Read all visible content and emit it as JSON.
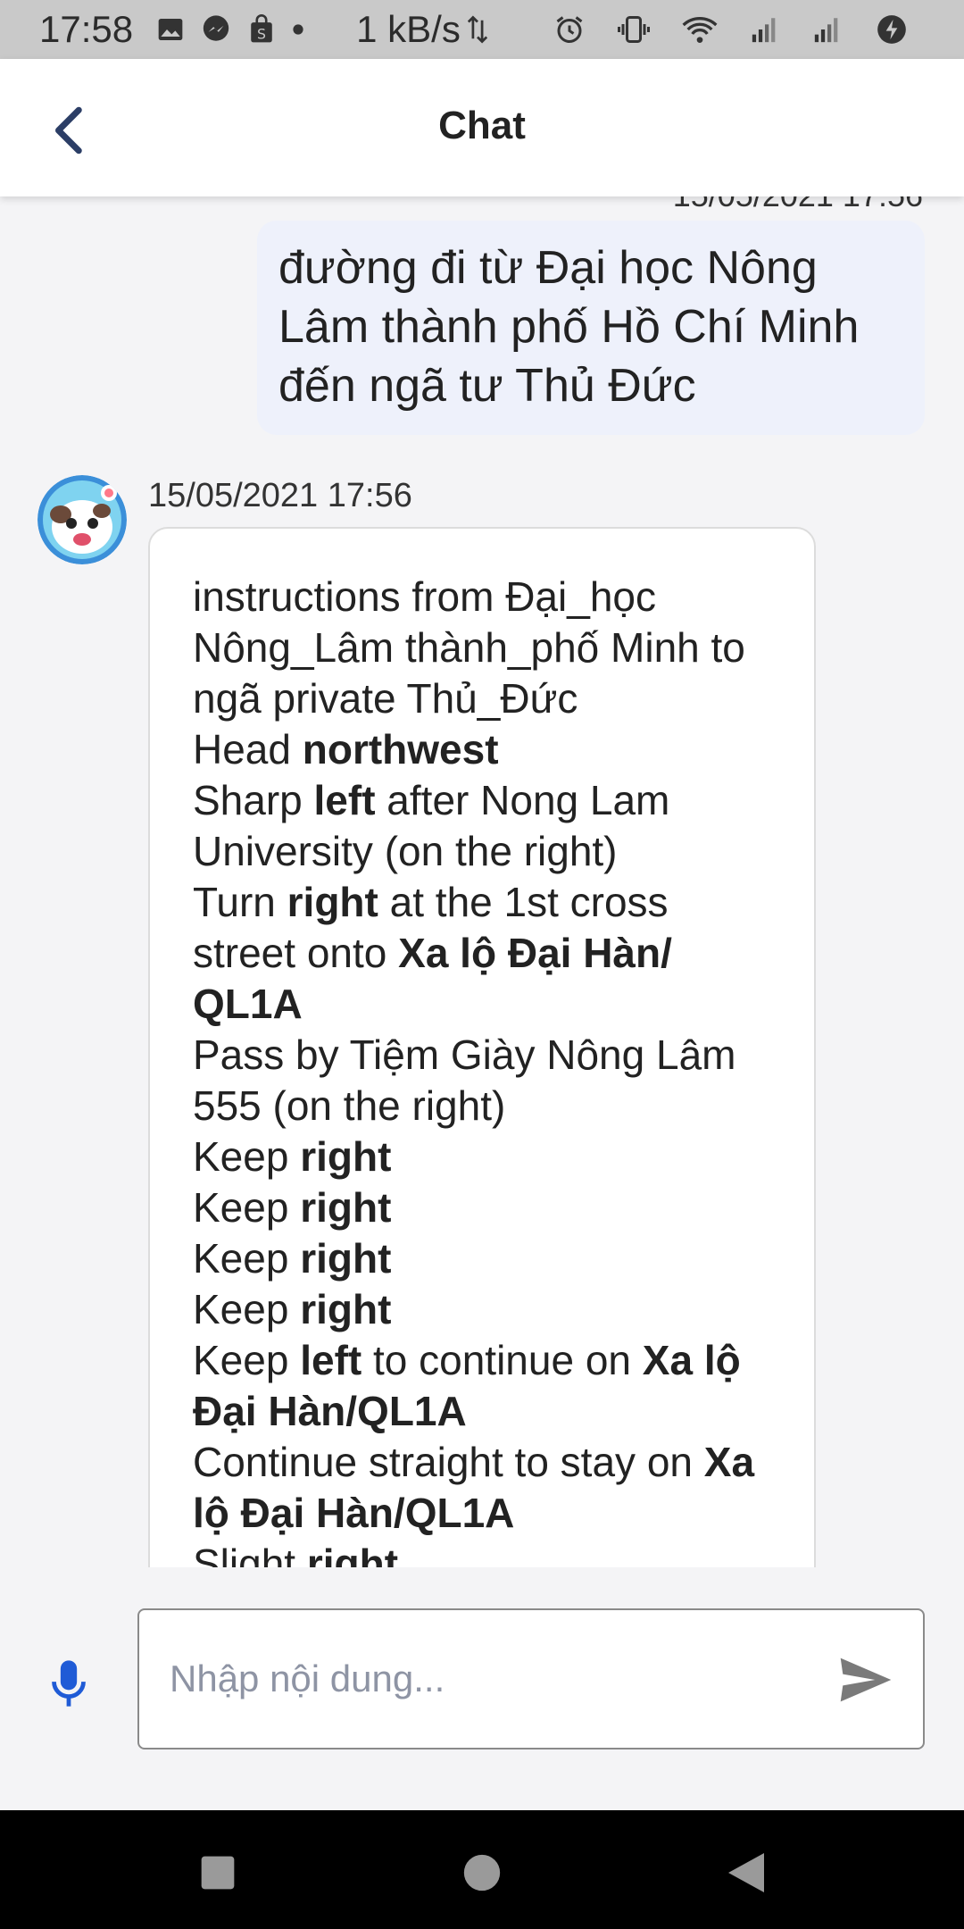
{
  "status_bar": {
    "time": "17:58",
    "net_speed": "1 kB/s",
    "icons_left": [
      "image-icon",
      "messenger-icon",
      "shop-icon",
      "dot-icon"
    ],
    "icons_right": [
      "alarm-icon",
      "vibrate-icon",
      "wifi-icon",
      "signal-icon",
      "signal-icon-2",
      "battery-saver-icon"
    ]
  },
  "header": {
    "title": "Chat",
    "back_icon": "chevron-left-icon"
  },
  "messages": {
    "prev_timestamp": "15/05/2021 17:56",
    "user_text": "đường đi từ Đại học Nông Lâm thành phố Hồ Chí Minh đến ngã tư Thủ Đức",
    "bot_timestamp": "15/05/2021 17:56",
    "bot_lines": [
      {
        "parts": [
          "instructions from Đại_học Nông_Lâm thành_phố Minh to ngã private Thủ_Đức"
        ]
      },
      {
        "parts": [
          "Head ",
          "northwest"
        ]
      },
      {
        "parts": [
          "Sharp ",
          "left",
          " after Nong Lam University (on the right)"
        ]
      },
      {
        "parts": [
          "Turn ",
          "right",
          " at the 1st cross street onto ",
          "Xa lộ Đại Hàn/ QL1A"
        ]
      },
      {
        "parts": [
          "Pass by Tiệm Giày Nông Lâm 555 (on the right)"
        ]
      },
      {
        "parts": [
          "Keep ",
          "right"
        ]
      },
      {
        "parts": [
          "Keep ",
          "right"
        ]
      },
      {
        "parts": [
          "Keep ",
          "right"
        ]
      },
      {
        "parts": [
          "Keep ",
          "right"
        ]
      },
      {
        "parts": [
          "Keep ",
          "left",
          " to continue on ",
          "Xa lộ Đại Hàn/QL1A"
        ]
      },
      {
        "parts": [
          "Continue straight to stay on ",
          "Xa lộ Đại Hàn/QL1A"
        ]
      },
      {
        "parts": [
          "Slight ",
          "right"
        ]
      }
    ]
  },
  "input": {
    "placeholder": "Nhập nội dung...",
    "value": "",
    "mic_icon": "microphone-icon",
    "send_icon": "send-icon"
  },
  "nav": {
    "recents_icon": "square-icon",
    "home_icon": "circle-icon",
    "back_icon": "triangle-back-icon"
  },
  "colors": {
    "status_bar_bg": "#c9c9c9",
    "user_bubble_bg": "#eef1fb",
    "accent_blue": "#1f5bd6",
    "back_arrow": "#2c3e66"
  }
}
